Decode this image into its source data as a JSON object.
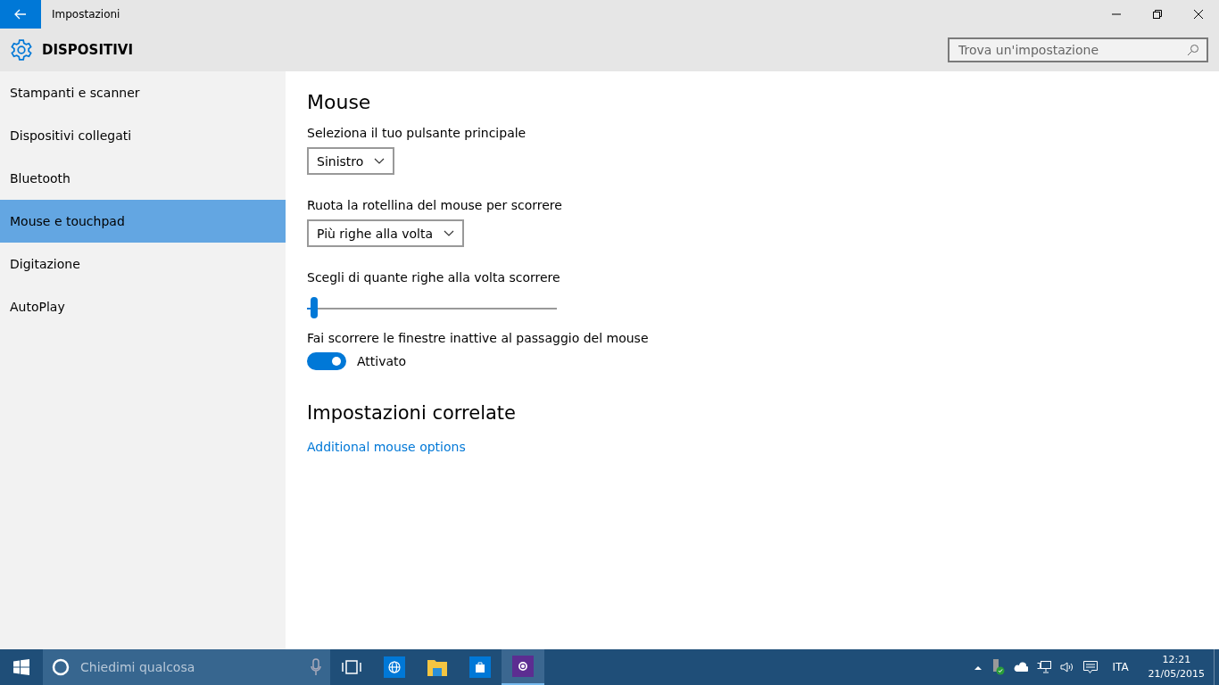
{
  "window": {
    "title": "Impostazioni"
  },
  "header": {
    "title": "DISPOSITIVI",
    "search": {
      "placeholder": "Trova un'impostazione"
    }
  },
  "sidebar": {
    "items": [
      {
        "label": "Stampanti e scanner",
        "selected": false
      },
      {
        "label": "Dispositivi collegati",
        "selected": false
      },
      {
        "label": "Bluetooth",
        "selected": false
      },
      {
        "label": "Mouse e touchpad",
        "selected": true
      },
      {
        "label": "Digitazione",
        "selected": false
      },
      {
        "label": "AutoPlay",
        "selected": false
      }
    ]
  },
  "content": {
    "title": "Mouse",
    "settings": [
      {
        "kind": "dropdown",
        "label": "Seleziona il tuo pulsante principale",
        "value": "Sinistro"
      },
      {
        "kind": "dropdown",
        "label": "Ruota la rotellina del mouse per scorrere",
        "value": "Più righe alla volta"
      },
      {
        "kind": "slider",
        "label": "Scegli di quante righe alla volta scorrere",
        "level": 0.03
      },
      {
        "kind": "toggle",
        "label": "Fai scorrere le finestre inattive al passaggio del mouse",
        "on": true,
        "state_label": "Attivato"
      }
    ],
    "related_title": "Impostazioni correlate",
    "related_link": "Additional mouse options"
  },
  "taskbar": {
    "search_placeholder": "Chiedimi qualcosa",
    "apps": [
      {
        "kind": "task-view",
        "selected": false
      },
      {
        "kind": "browser",
        "selected": false
      },
      {
        "kind": "explorer",
        "selected": false
      },
      {
        "kind": "store",
        "selected": false
      },
      {
        "kind": "settings",
        "selected": true
      }
    ],
    "language": "ITA",
    "time": "12:21",
    "date": "21/05/2015"
  }
}
